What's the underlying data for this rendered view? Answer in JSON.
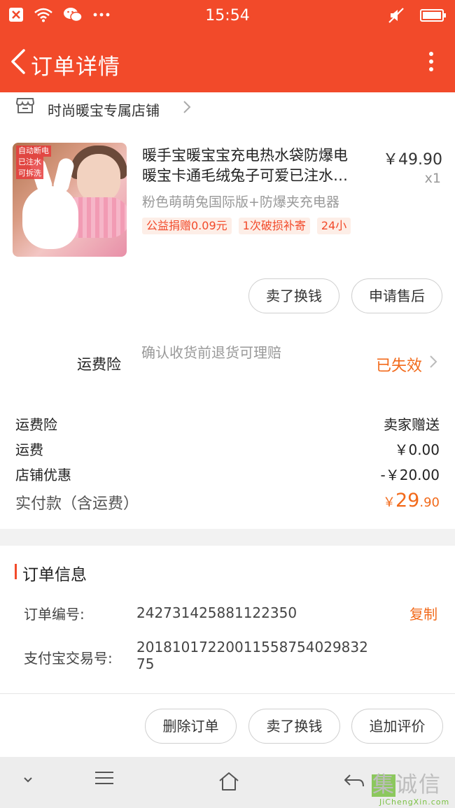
{
  "status_bar": {
    "time": "15:54"
  },
  "header": {
    "title": "订单详情"
  },
  "shop": {
    "name": "时尚暖宝专属店铺"
  },
  "product": {
    "title_line1": "暖手宝暖宝宝充电热水袋防爆电",
    "title_line2": "暖宝卡通毛绒兔子可爱已注水…",
    "price": "￥49.90",
    "quantity": "x1",
    "spec": "粉色萌萌兔国际版+防爆夹充电器",
    "badges": [
      "公益捐赠0.09元",
      "1次破损补寄",
      "24小"
    ],
    "image_tags": [
      "自动断电",
      "已注水",
      "可拆洗"
    ]
  },
  "item_actions": {
    "sell_label": "卖了换钱",
    "after_sale_label": "申请售后"
  },
  "insurance": {
    "label": "运费险",
    "description": "确认收货前退货可理赔",
    "status": "已失效"
  },
  "costs": {
    "rows": [
      {
        "label": "运费险",
        "value": "卖家赠送"
      },
      {
        "label": "运费",
        "value": "￥0.00"
      },
      {
        "label": "店铺优惠",
        "value": "-￥20.00"
      }
    ],
    "total_label": "实付款（含运费）",
    "total_currency": "￥",
    "total_integer": "29",
    "total_decimal": ".90"
  },
  "order_info": {
    "title": "订单信息",
    "order_no_label": "订单编号:",
    "order_no": "242731425881122350",
    "copy_label": "复制",
    "alipay_label": "支付宝交易号:",
    "alipay_no": "20181017220011558754029832 75"
  },
  "bottom_actions": {
    "delete_label": "删除订单",
    "sell_label": "卖了换钱",
    "review_label": "追加评价"
  },
  "watermark": {
    "brand": "集诚信",
    "domain": "JiChengXin.com"
  },
  "colors": {
    "accent": "#f24a2a",
    "price_orange": "#f26a1b"
  }
}
